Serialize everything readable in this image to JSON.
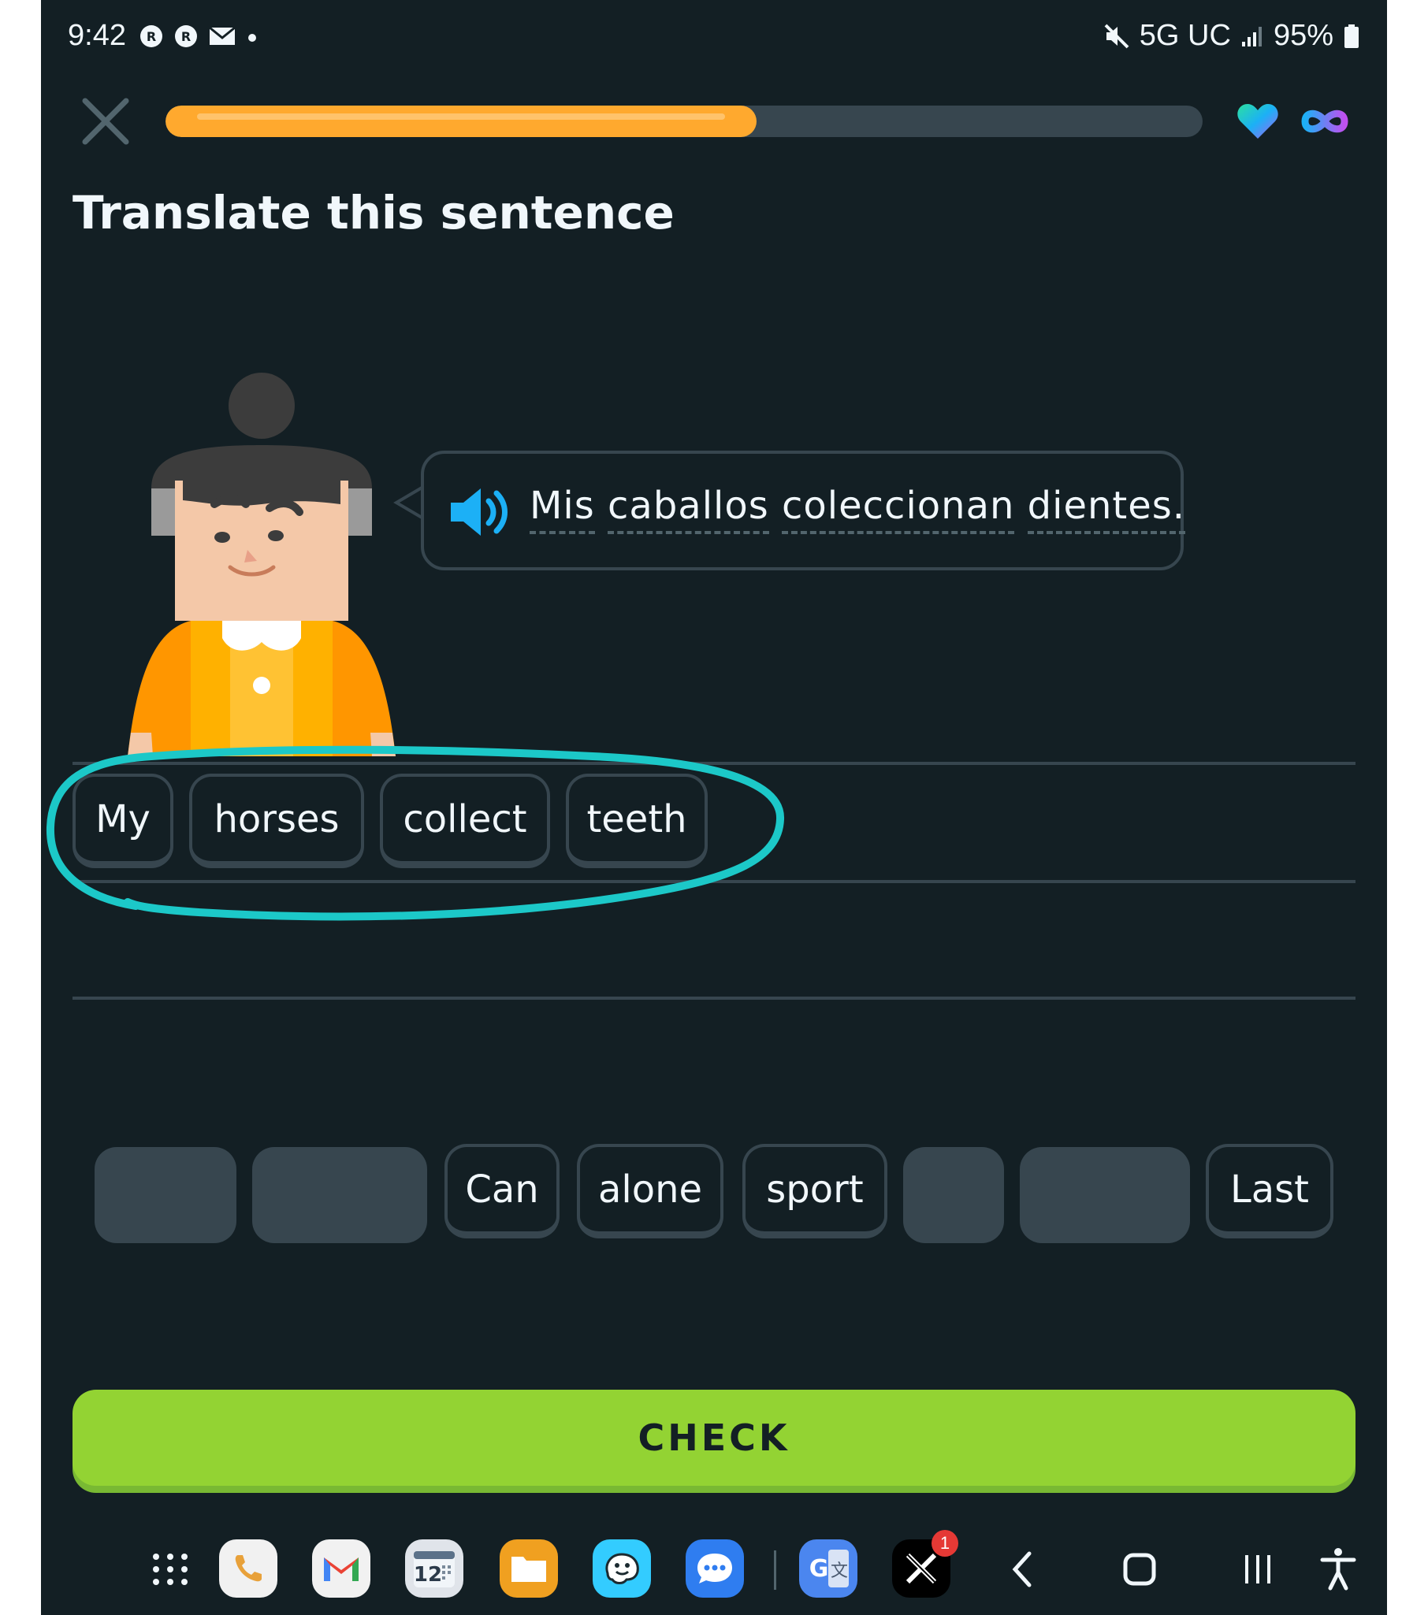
{
  "status_bar": {
    "time": "9:42",
    "network": "5G UC",
    "battery": "95%",
    "icons": [
      "reddit-icon",
      "reddit-icon",
      "mail-icon",
      "dot-icon",
      "mute-icon",
      "signal-icon",
      "battery-icon"
    ]
  },
  "lesson": {
    "progress": 0.57,
    "title": "Translate this sentence",
    "prompt_words": [
      "Mis",
      "caballos",
      "coleccionan",
      "dientes."
    ],
    "answer_words": [
      "My",
      "horses",
      "collect",
      "teeth"
    ],
    "word_bank": [
      {
        "label": "",
        "used": true
      },
      {
        "label": "",
        "used": true
      },
      {
        "label": "Can",
        "used": false
      },
      {
        "label": "alone",
        "used": false
      },
      {
        "label": "sport",
        "used": false
      },
      {
        "label": "",
        "used": true
      },
      {
        "label": "",
        "used": true
      },
      {
        "label": "Last",
        "used": false
      }
    ],
    "check_label": "CHECK"
  },
  "colors": {
    "background": "#131f24",
    "progress": "#ffa92e",
    "check": "#93d333",
    "annotation": "#1cc8c8",
    "speaker": "#1cb0f6"
  },
  "taskbar": {
    "apps": [
      "apps-grid-icon",
      "phone-icon",
      "gmail-icon",
      "calendar-icon",
      "files-icon",
      "waze-icon",
      "messages-icon",
      "google-translate-icon",
      "x-icon"
    ],
    "calendar_day": "12",
    "x_badge": "1",
    "nav": [
      "back-icon",
      "home-icon",
      "recents-icon",
      "accessibility-icon"
    ]
  }
}
